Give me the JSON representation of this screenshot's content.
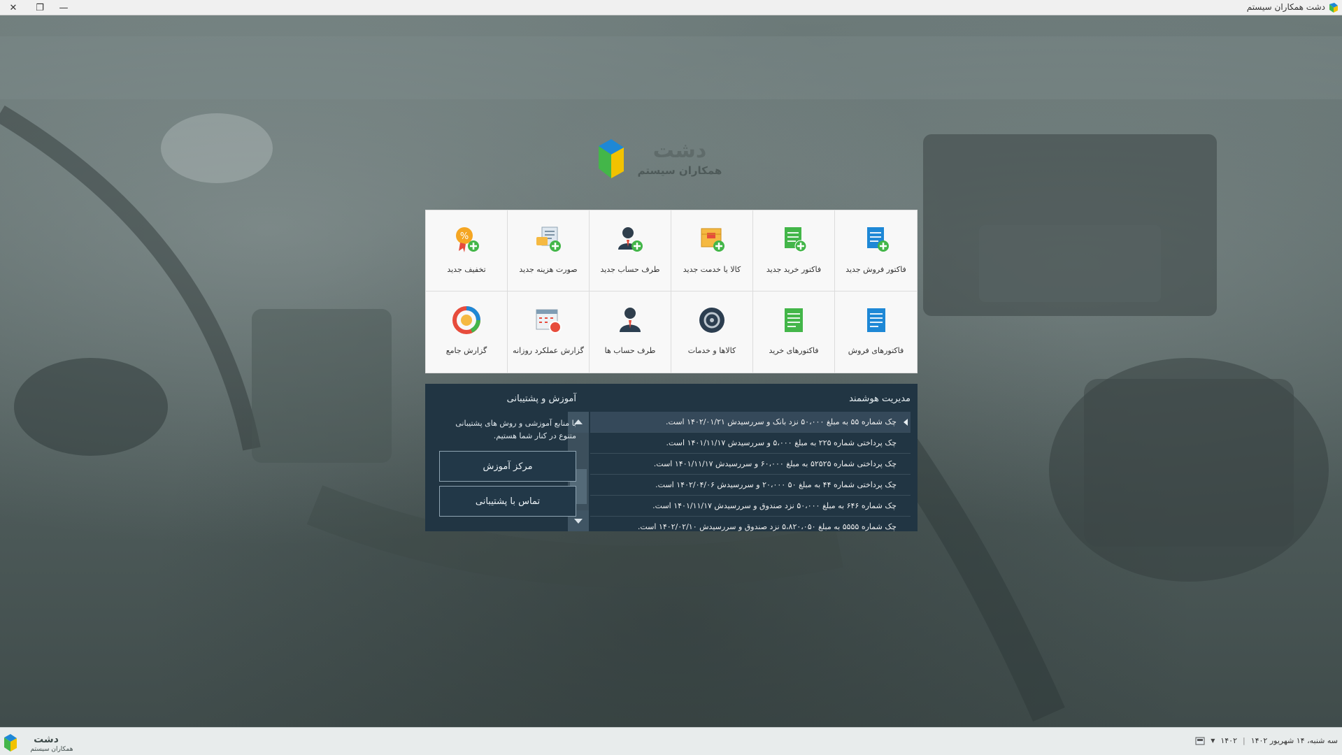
{
  "window": {
    "title": "دشت همکاران سیستم",
    "close_glyph": "✕",
    "restore_glyph": "❐",
    "minimize_glyph": "—"
  },
  "logo": {
    "main": "دشت",
    "sub": "همکاران سیستم"
  },
  "tiles": [
    {
      "label": "فاکتور فروش جدید",
      "icon": "sales-invoice-add-icon"
    },
    {
      "label": "فاکتور خرید جدید",
      "icon": "purchase-invoice-add-icon"
    },
    {
      "label": "کالا یا خدمت جدید",
      "icon": "product-add-icon"
    },
    {
      "label": "طرف حساب جدید",
      "icon": "person-add-icon"
    },
    {
      "label": "صورت هزینه جدید",
      "icon": "expense-add-icon"
    },
    {
      "label": "تخفیف جدید",
      "icon": "discount-add-icon"
    },
    {
      "label": "فاکتورهای فروش",
      "icon": "sales-invoices-icon"
    },
    {
      "label": "فاکتورهای خرید",
      "icon": "purchase-invoices-icon"
    },
    {
      "label": "کالاها و خدمات",
      "icon": "products-icon"
    },
    {
      "label": "طرف حساب ها",
      "icon": "persons-icon"
    },
    {
      "label": "گزارش عملکرد روزانه",
      "icon": "daily-report-icon"
    },
    {
      "label": "گزارش جامع",
      "icon": "comprehensive-report-icon"
    }
  ],
  "smart_management": {
    "title": "مدیریت هوشمند",
    "items": [
      "چک شماره ۵۵ به مبلغ ۵۰،۰۰۰ نزد بانک و سررسیدش ۱۴۰۲/۰۱/۲۱ است.",
      "چک پرداختی شماره ۲۲۵ به مبلغ  ۵،۰۰۰ و سررسیدش ۱۴۰۱/۱۱/۱۷ است.",
      "چک پرداختی شماره ۵۲۵۲۵ به مبلغ  ۶۰،۰۰۰ و سررسیدش ۱۴۰۱/۱۱/۱۷ است.",
      "چک پرداختی شماره ۴۴ به مبلغ ۵۰  ۲۰،۰۰۰ و سررسیدش ۱۴۰۲/۰۴/۰۶ است.",
      "چک شماره ۶۴۶ به مبلغ ۵۰،۰۰۰ نزد صندوق و سررسیدش ۱۴۰۱/۱۱/۱۷ است.",
      "چک شماره ۵۵۵۵ به مبلغ ۵،۸۲۰،۰۵۰ نزد صندوق و سررسیدش ۱۴۰۲/۰۲/۱۰ است."
    ]
  },
  "support": {
    "title": "آموزش و  پشتیبانی",
    "description": "با منابع آموزشی و روش های پشتیبانی متنوع در کنار شما هستیم.",
    "training_button": "مرکز آموزش",
    "contact_button": "تماس با پشتیبانی"
  },
  "statusbar": {
    "date": "سه شنبه، ۱۴ شهریور ۱۴۰۲",
    "fiscal_year": "۱۴۰۲",
    "logo_main": "دشت",
    "logo_sub": "همکاران سیستم"
  },
  "colors": {
    "panel": "#213543",
    "accent_blue": "#1e88d6",
    "accent_green": "#43b649",
    "tile_bg": "#f8f8f8"
  }
}
